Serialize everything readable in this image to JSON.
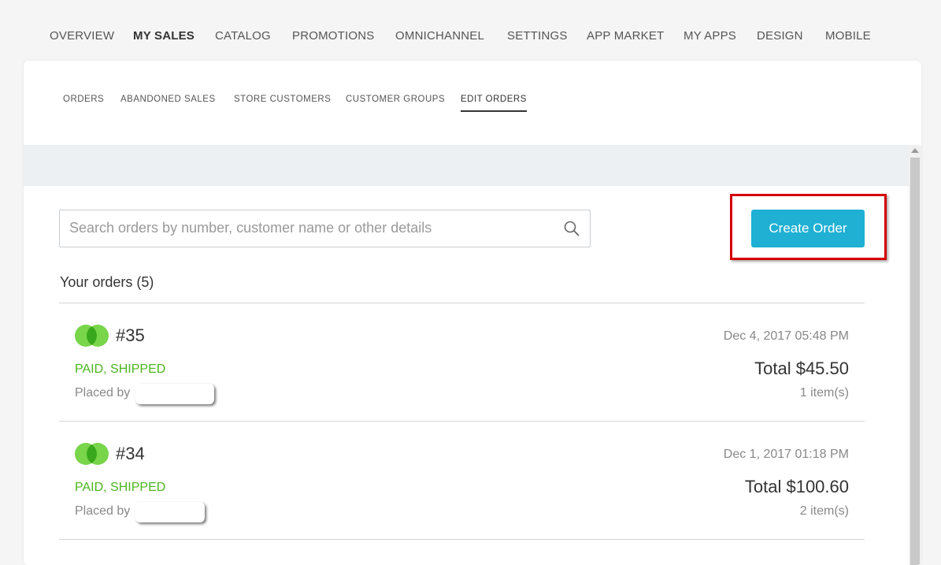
{
  "top_nav": {
    "items": [
      {
        "label": "OVERVIEW"
      },
      {
        "label": "MY SALES",
        "active": true
      },
      {
        "label": "CATALOG"
      },
      {
        "label": "PROMOTIONS"
      },
      {
        "label": "OMNICHANNEL"
      },
      {
        "label": "SETTINGS"
      },
      {
        "label": "APP MARKET"
      },
      {
        "label": "MY APPS"
      },
      {
        "label": "DESIGN"
      },
      {
        "label": "MOBILE"
      }
    ]
  },
  "sub_nav": {
    "items": [
      {
        "label": "ORDERS"
      },
      {
        "label": "ABANDONED SALES"
      },
      {
        "label": "STORE CUSTOMERS"
      },
      {
        "label": "CUSTOMER GROUPS"
      },
      {
        "label": "EDIT ORDERS",
        "active": true
      }
    ]
  },
  "search": {
    "placeholder": "Search orders by number, customer name or other details",
    "value": "",
    "icon": "search-icon"
  },
  "create_order": {
    "label": "Create Order",
    "color": "#1fb0d3",
    "highlight_color": "#d40000"
  },
  "orders_heading": "Your orders (5)",
  "orders": [
    {
      "number": "#35",
      "date": "Dec 4, 2017 05:48 PM",
      "status": "PAID, SHIPPED",
      "total": "Total $45.50",
      "placed_by_label": "Placed by",
      "items": "1 item(s)"
    },
    {
      "number": "#34",
      "date": "Dec 1, 2017 01:18 PM",
      "status": "PAID, SHIPPED",
      "total": "Total $100.60",
      "placed_by_label": "Placed by",
      "items": "2 item(s)"
    }
  ],
  "colors": {
    "status_green": "#4cb520",
    "status_icon_light": "#79d54a",
    "status_icon_dark": "#3aa81c"
  }
}
